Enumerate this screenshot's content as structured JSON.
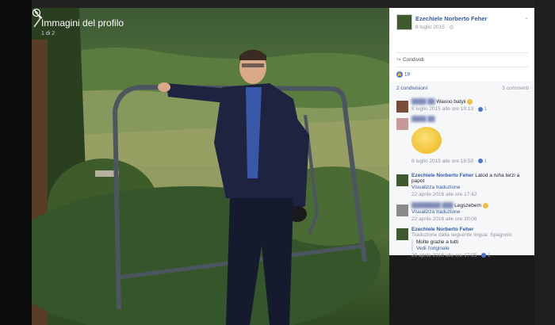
{
  "viewer": {
    "album_title": "Immagini del profilo",
    "counter": "1 di 2"
  },
  "post": {
    "author": "Ezechiele Norberto Feher",
    "date": "8 luglio 2015 · ",
    "privacy_icon": "globe-icon",
    "share_label": "Condividi",
    "likes_count": "19",
    "shares_label": "2 condivisioni",
    "comments_label": "5 commenti"
  },
  "comments": [
    {
      "author": "████ ██",
      "text": "Waooo batyii",
      "meta": "8 luglio 2015 alle ore 19:13 · ",
      "likes": "1"
    },
    {
      "author": "████ ██",
      "text": "",
      "meta": "8 luglio 2015 alle ore 19:59 · ",
      "likes": "1",
      "sticker": "smiley-sticker"
    },
    {
      "author": "Ezechiele Norberto Feher",
      "text": "Latod a ruha terzi a papot",
      "link": "Visualizza traduzione",
      "meta": "22 aprile 2016 alle ore 17:42"
    },
    {
      "author": "████████ ███",
      "text": "Legszebem",
      "link": "Visualizza traduzione",
      "meta": "22 aprile 2016 alle ore 20:06"
    },
    {
      "author": "Ezechiele Norberto Feher",
      "note": "Traduzione dalla seguente lingua: Spagnolo",
      "translated": "Molte grazie a tutti",
      "link": "Vedi l'originale",
      "meta": "29 aprile 2016 alle ore 17:05 · ",
      "likes": "1"
    }
  ],
  "colors": {
    "link": "#365899",
    "meta": "#90949c",
    "like": "#4a76d0"
  }
}
